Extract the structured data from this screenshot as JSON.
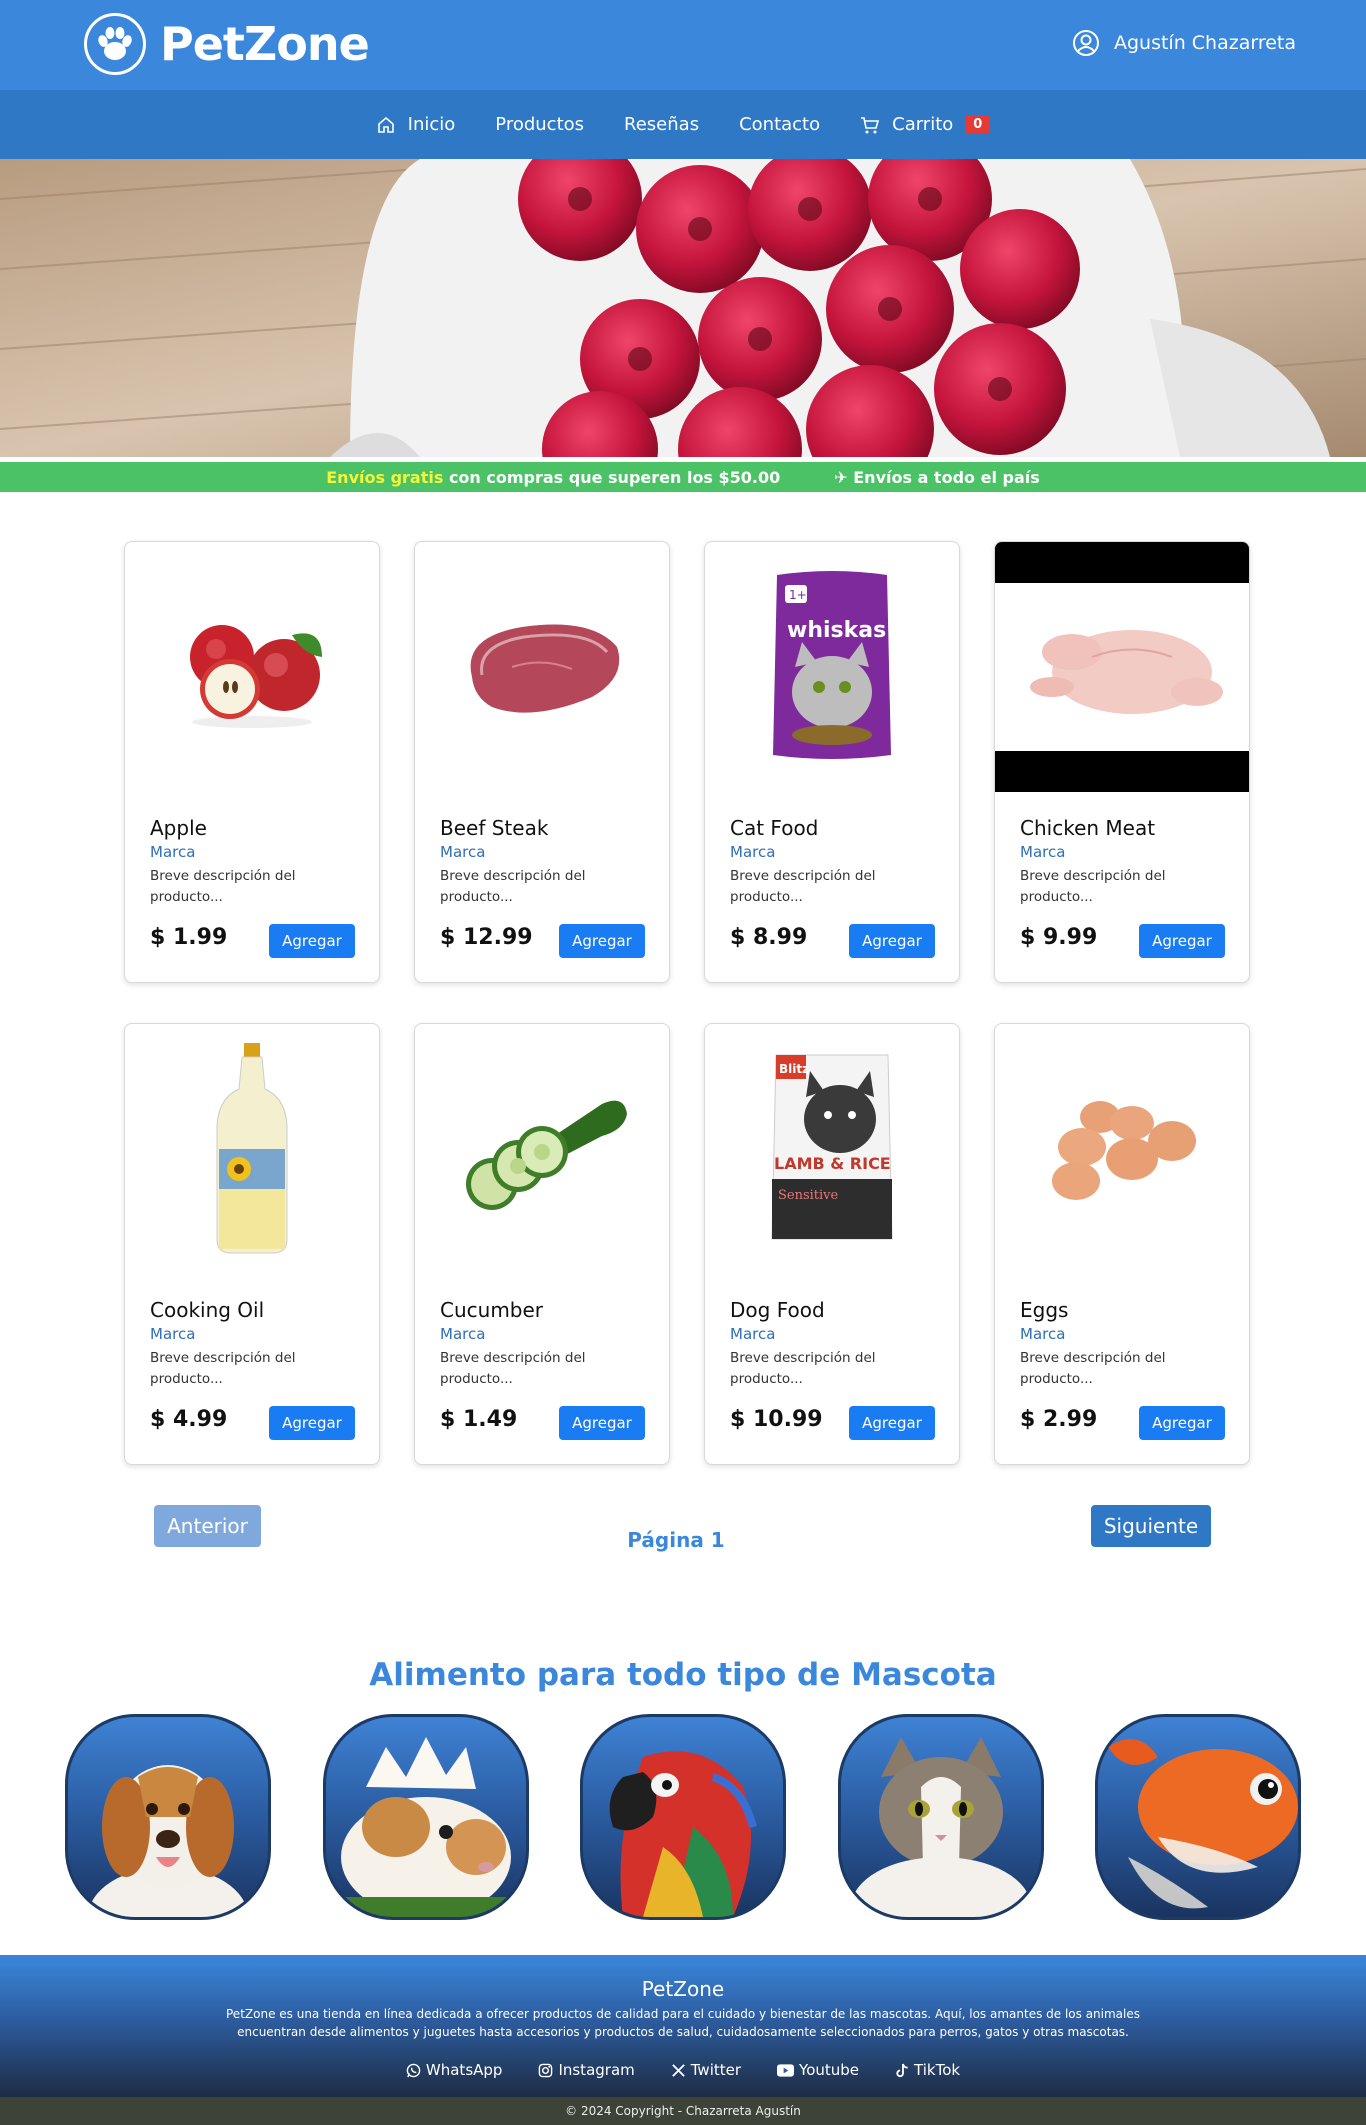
{
  "header": {
    "logo_text": "PetZone",
    "user_name": "Agustín Chazarreta"
  },
  "nav": {
    "items": [
      {
        "label": "Inicio",
        "icon": "home-icon"
      },
      {
        "label": "Productos"
      },
      {
        "label": "Reseñas"
      },
      {
        "label": "Contacto"
      },
      {
        "label": "Carrito",
        "icon": "cart-icon"
      }
    ],
    "cart_count": "0"
  },
  "banner": {
    "highlight": "Envíos gratis",
    "text": " con compras que superen los $50.00",
    "shipping": "✈ Envíos a todo el país"
  },
  "products": [
    {
      "name": "Apple",
      "brand": "Marca",
      "desc": "Breve descripción del producto...",
      "price": "$ 1.99",
      "button": "Agregar",
      "image": "apple-image"
    },
    {
      "name": "Beef Steak",
      "brand": "Marca",
      "desc": "Breve descripción del producto...",
      "price": "$ 12.99",
      "button": "Agregar",
      "image": "beef-steak-image"
    },
    {
      "name": "Cat Food",
      "brand": "Marca",
      "desc": "Breve descripción del producto...",
      "price": "$ 8.99",
      "button": "Agregar",
      "image": "cat-food-image"
    },
    {
      "name": "Chicken Meat",
      "brand": "Marca",
      "desc": "Breve descripción del producto...",
      "price": "$ 9.99",
      "button": "Agregar",
      "image": "chicken-meat-image"
    },
    {
      "name": "Cooking Oil",
      "brand": "Marca",
      "desc": "Breve descripción del producto...",
      "price": "$ 4.99",
      "button": "Agregar",
      "image": "cooking-oil-image"
    },
    {
      "name": "Cucumber",
      "brand": "Marca",
      "desc": "Breve descripción del producto...",
      "price": "$ 1.49",
      "button": "Agregar",
      "image": "cucumber-image"
    },
    {
      "name": "Dog Food",
      "brand": "Marca",
      "desc": "Breve descripción del producto...",
      "price": "$ 10.99",
      "button": "Agregar",
      "image": "dog-food-image"
    },
    {
      "name": "Eggs",
      "brand": "Marca",
      "desc": "Breve descripción del producto...",
      "price": "$ 2.99",
      "button": "Agregar",
      "image": "eggs-image"
    }
  ],
  "product_labels": {
    "whiskas": "whiskas",
    "lamb_rice": "LAMB & RICE",
    "sensitive": "Sensitive",
    "blitz": "Blitz"
  },
  "pagination": {
    "prev": "Anterior",
    "page": "Página 1",
    "next": "Siguiente"
  },
  "pets_section": {
    "title": "Alimento para todo tipo de Mascota",
    "pets": [
      "dog-image",
      "guinea-pig-image",
      "parrot-image",
      "cat-image",
      "goldfish-image"
    ]
  },
  "footer": {
    "title": "PetZone",
    "description": "PetZone es una tienda en línea dedicada a ofrecer productos de calidad para el cuidado y bienestar de las mascotas. Aquí, los amantes de los animales encuentran desde alimentos y juguetes hasta accesorios y productos de salud, cuidadosamente seleccionados para perros, gatos y otras mascotas.",
    "socials": [
      "WhatsApp",
      "Instagram",
      "Twitter",
      "Youtube",
      "TikTok"
    ],
    "copyright": "© 2024 Copyright - Chazarreta Agustín"
  },
  "colors": {
    "header": "#3a87dc",
    "nav": "#2f78c6",
    "banner": "#4cc267",
    "button": "#1a7cf2",
    "badge": "#e53935"
  }
}
